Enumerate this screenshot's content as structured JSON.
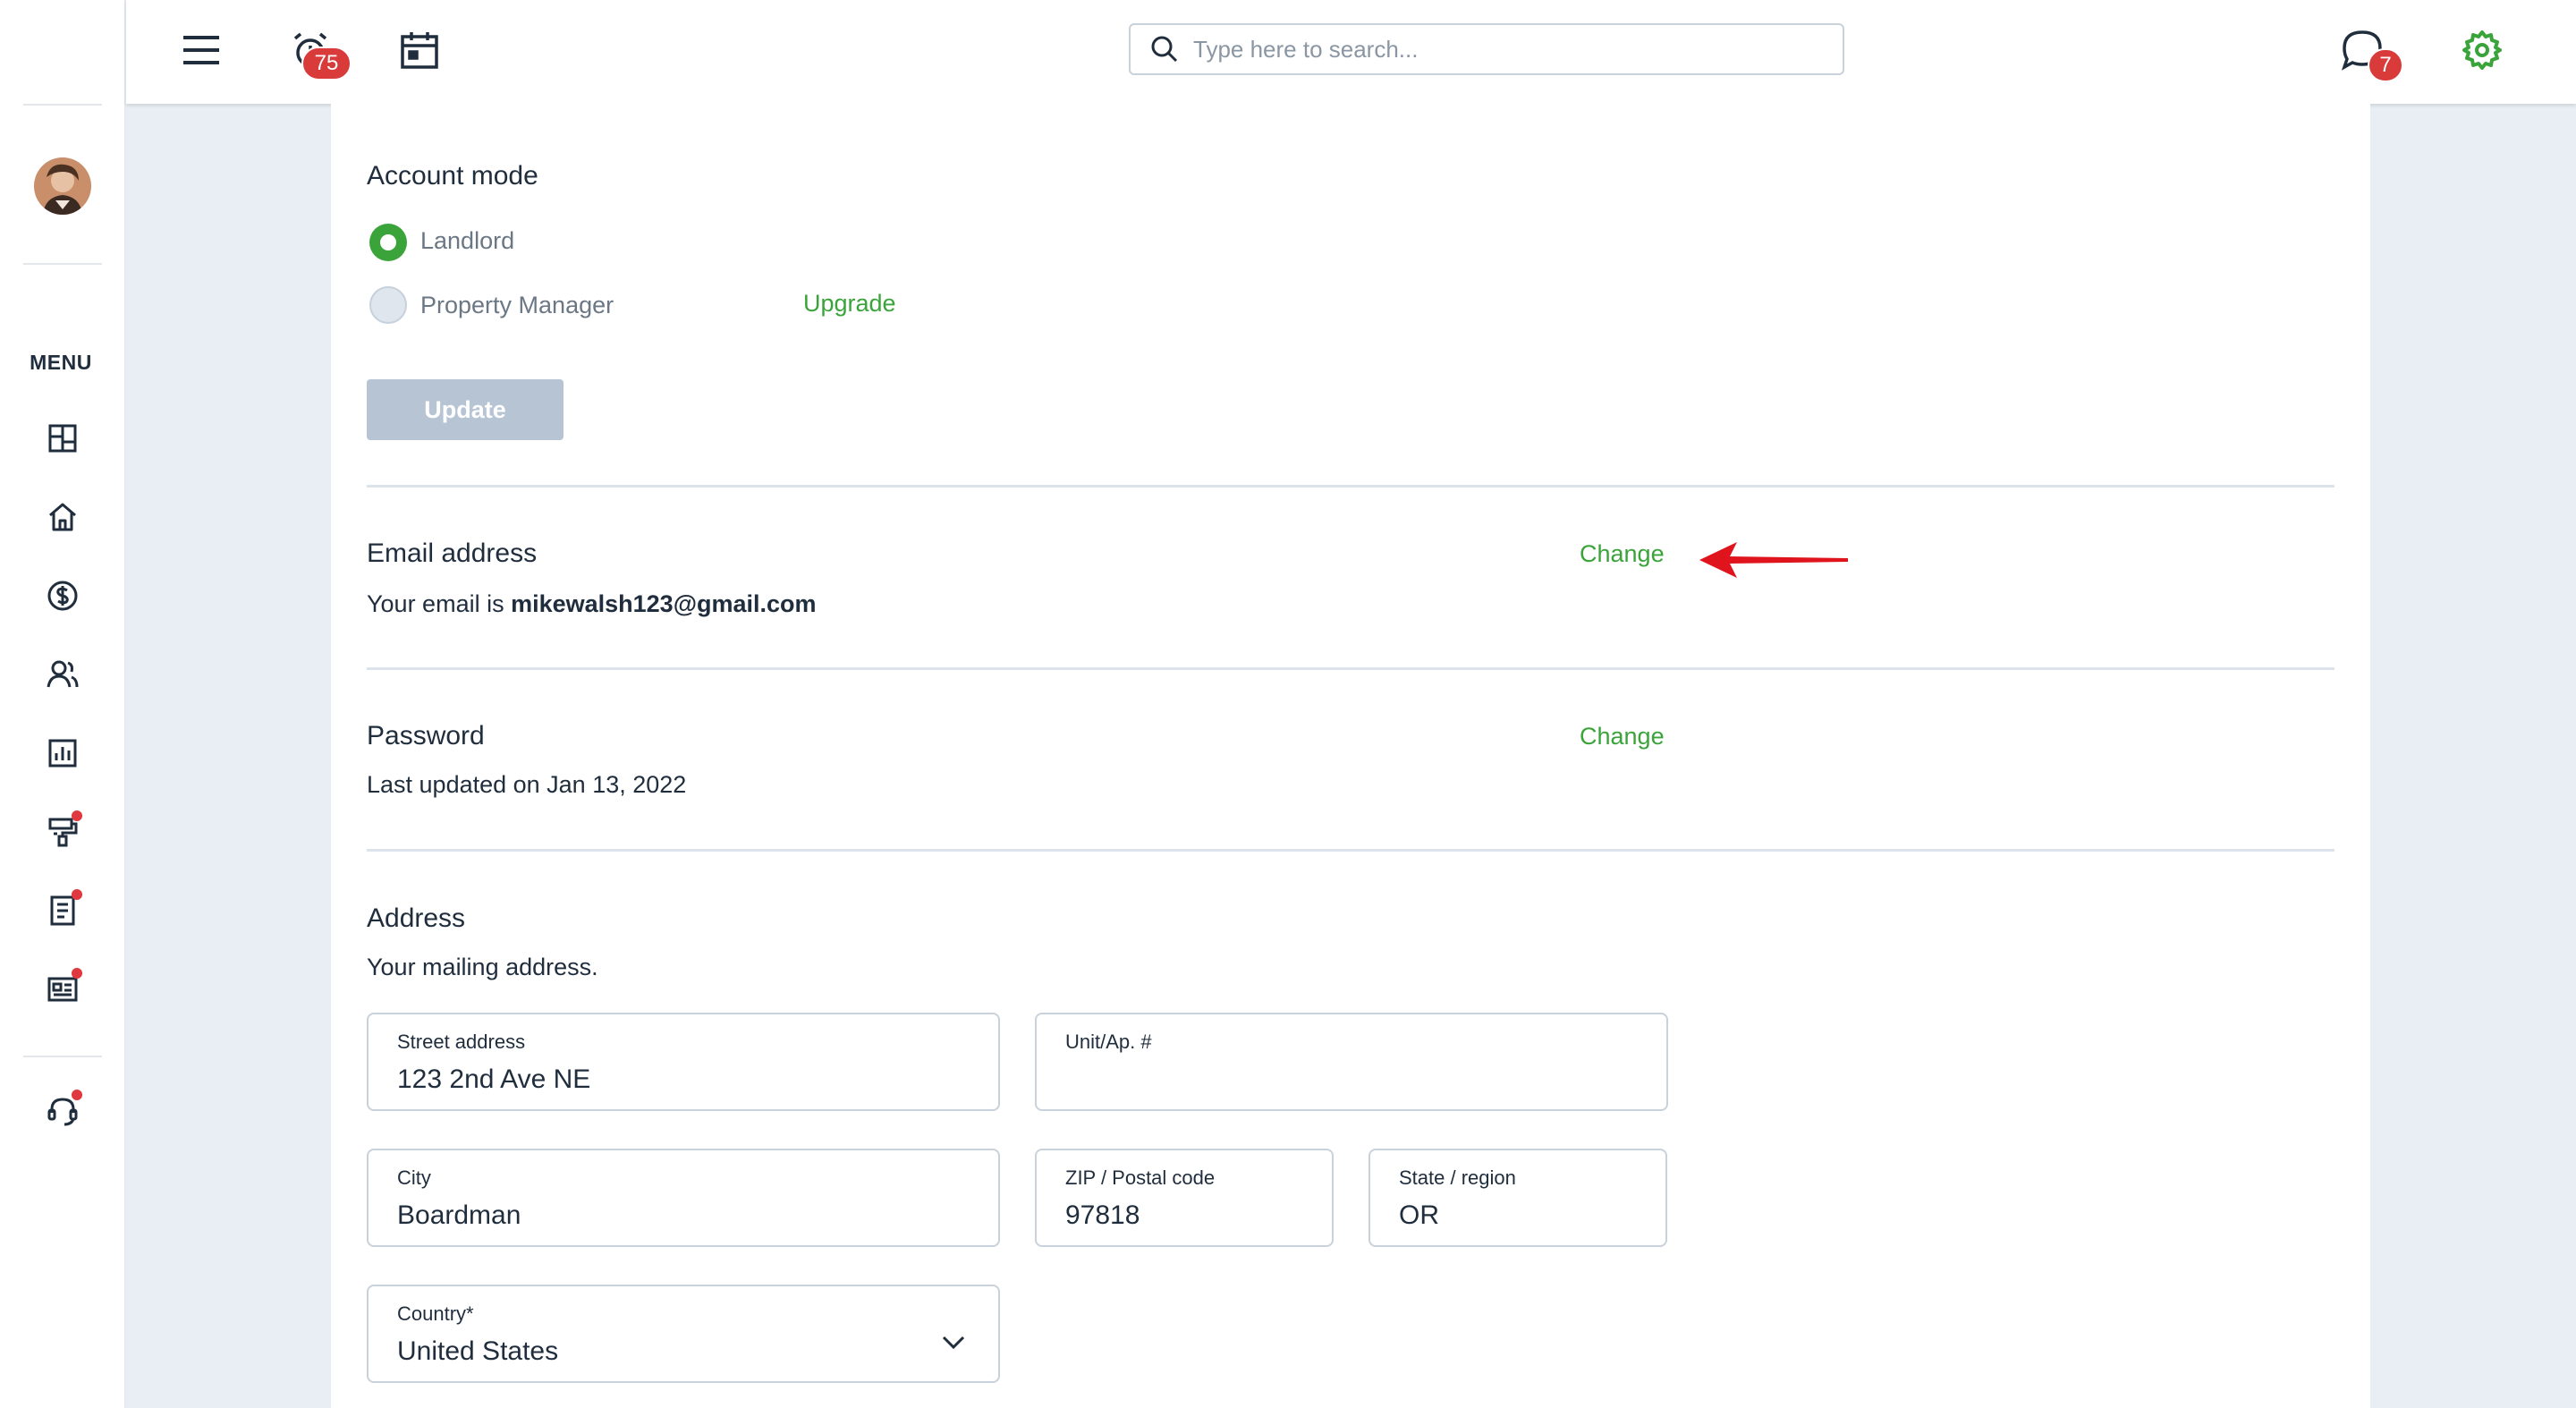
{
  "topbar": {
    "alarm_badge": "75",
    "search_placeholder": "Type here to search...",
    "chat_badge": "7"
  },
  "sidebar": {
    "menu_label": "MENU"
  },
  "account_mode": {
    "title": "Account mode",
    "options": [
      {
        "label": "Landlord",
        "selected": true
      },
      {
        "label": "Property Manager",
        "selected": false
      }
    ],
    "upgrade_label": "Upgrade",
    "update_label": "Update"
  },
  "email": {
    "title": "Email address",
    "change_label": "Change",
    "prefix": "Your email is ",
    "value": "mikewalsh123@gmail.com"
  },
  "password": {
    "title": "Password",
    "change_label": "Change",
    "last_updated": "Last updated on Jan 13, 2022"
  },
  "address": {
    "title": "Address",
    "subtitle": "Your mailing address.",
    "street_label": "Street address",
    "street_value": "123 2nd Ave NE",
    "unit_label": "Unit/Ap. #",
    "unit_value": "",
    "city_label": "City",
    "city_value": "Boardman",
    "zip_label": "ZIP / Postal code",
    "zip_value": "97818",
    "state_label": "State / region",
    "state_value": "OR",
    "country_label": "Country*",
    "country_value": "United States"
  },
  "colors": {
    "accent": "#3aa43a",
    "badge": "#d93a3a",
    "arrow": "#e0141c"
  }
}
